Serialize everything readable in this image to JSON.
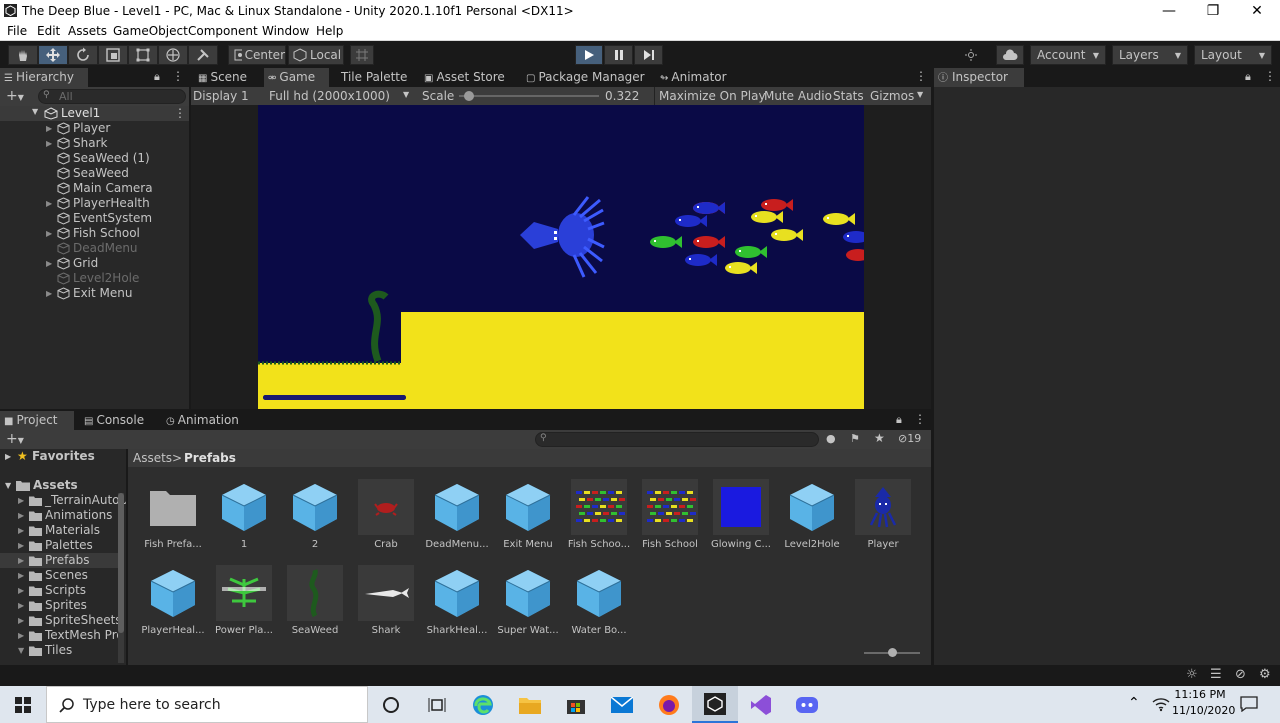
{
  "window": {
    "title": "The Deep Blue - Level1 - PC, Mac & Linux Standalone - Unity 2020.1.10f1 Personal <DX11>"
  },
  "menu": [
    "File",
    "Edit",
    "Assets",
    "GameObject",
    "Component",
    "Window",
    "Help"
  ],
  "toolbar": {
    "pivot": "Center",
    "space": "Local",
    "account": "Account",
    "layers": "Layers",
    "layout": "Layout"
  },
  "hierarchy": {
    "tab": "Hierarchy",
    "search_placeholder": "All",
    "scene": "Level1",
    "items": [
      {
        "label": "Player",
        "expandable": true,
        "disabled": false
      },
      {
        "label": "Shark",
        "expandable": true,
        "disabled": false
      },
      {
        "label": "SeaWeed (1)",
        "expandable": false,
        "disabled": false
      },
      {
        "label": "SeaWeed",
        "expandable": false,
        "disabled": false
      },
      {
        "label": "Main Camera",
        "expandable": false,
        "disabled": false
      },
      {
        "label": "PlayerHealth",
        "expandable": true,
        "disabled": false
      },
      {
        "label": "EventSystem",
        "expandable": false,
        "disabled": false
      },
      {
        "label": "Fish School",
        "expandable": true,
        "disabled": false
      },
      {
        "label": "DeadMenu",
        "expandable": false,
        "disabled": true
      },
      {
        "label": "Grid",
        "expandable": true,
        "disabled": false
      },
      {
        "label": "Level2Hole",
        "expandable": false,
        "disabled": true
      },
      {
        "label": "Exit Menu",
        "expandable": true,
        "disabled": false
      }
    ]
  },
  "center_tabs": [
    "Scene",
    "Game",
    "Tile Palette",
    "Asset Store",
    "Package Manager",
    "Animator"
  ],
  "game_view": {
    "display": "Display 1",
    "resolution": "Full hd (2000x1000)",
    "scale_label": "Scale",
    "scale_value": "0.322",
    "scale_fraction": 0.07,
    "maximize": "Maximize On Play",
    "mute": "Mute Audio",
    "stats": "Stats",
    "gizmos": "Gizmos",
    "player_health_fraction": 1.0
  },
  "inspector": {
    "tab": "Inspector"
  },
  "bottom_tabs": [
    "Project",
    "Console",
    "Animation"
  ],
  "project": {
    "hidden_count": "19",
    "favorites": "Favorites",
    "assets_root": "Assets",
    "folders": [
      "_TerrainAutoU",
      "Animations",
      "Materials",
      "Palettes",
      "Prefabs",
      "Scenes",
      "Scripts",
      "Sprites",
      "SpriteSheets",
      "TextMesh Pro",
      "Tiles"
    ],
    "selected_folder": "Prefabs",
    "breadcrumb": [
      "Assets",
      "Prefabs"
    ],
    "assets": [
      {
        "label": "Fish Prefa...",
        "kind": "folder"
      },
      {
        "label": "1",
        "kind": "prefab"
      },
      {
        "label": "2",
        "kind": "prefab"
      },
      {
        "label": "Crab",
        "kind": "crab"
      },
      {
        "label": "DeadMenu...",
        "kind": "prefab"
      },
      {
        "label": "Exit Menu",
        "kind": "prefab"
      },
      {
        "label": "Fish Schoo...",
        "kind": "fishschool"
      },
      {
        "label": "Fish School",
        "kind": "fishschool"
      },
      {
        "label": "Glowing C...",
        "kind": "bluebox"
      },
      {
        "label": "Level2Hole",
        "kind": "prefab"
      },
      {
        "label": "Player",
        "kind": "squid"
      },
      {
        "label": "PlayerHeal...",
        "kind": "prefab"
      },
      {
        "label": "Power Pla...",
        "kind": "powerplant"
      },
      {
        "label": "SeaWeed",
        "kind": "seaweed"
      },
      {
        "label": "Shark",
        "kind": "shark"
      },
      {
        "label": "SharkHeal...",
        "kind": "prefab"
      },
      {
        "label": "Super Wat...",
        "kind": "prefab"
      },
      {
        "label": "Water Bo...",
        "kind": "prefab"
      }
    ]
  },
  "taskbar": {
    "search_placeholder": "Type here to search",
    "time": "11:16 PM",
    "date": "11/10/2020"
  }
}
